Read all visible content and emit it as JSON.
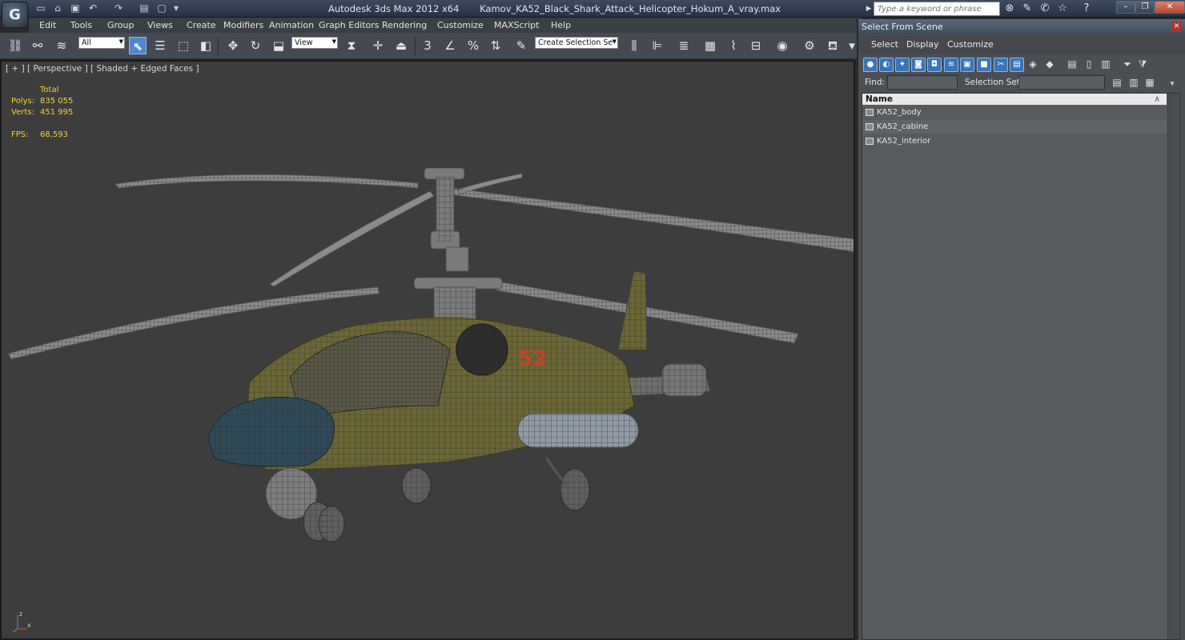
{
  "titlebar": {
    "app_name": "Autodesk 3ds Max  2012 x64",
    "file_name": "Kamov_KA52_Black_Shark_Attack_Helicopter_Hokum_A_vray.max",
    "search_placeholder": "Type a keyword or phrase",
    "logo_letter": "G"
  },
  "menu": [
    "Edit",
    "Tools",
    "Group",
    "Views",
    "Create",
    "Modifiers",
    "Animation",
    "Graph Editors",
    "Rendering",
    "Customize",
    "MAXScript",
    "Help"
  ],
  "toolbar": {
    "filter_select": "All",
    "reference_coord": "View",
    "selection_set": "Create Selection Se",
    "snap_label": "3",
    "percent_snap_label": "%"
  },
  "viewport": {
    "label": "[ + ] [ Perspective ] [ Shaded + Edged Faces ]",
    "stats": {
      "total_label": "Total",
      "polys_label": "Polys:",
      "polys_value": "835 055",
      "verts_label": "Verts:",
      "verts_value": "451 995",
      "fps_label": "FPS:",
      "fps_value": "68,593"
    },
    "axis": {
      "x": "x",
      "y": "y",
      "z": "z"
    },
    "helicopter_number": "52"
  },
  "panel": {
    "title": "Select From Scene",
    "menu": [
      "Select",
      "Display",
      "Customize"
    ],
    "find_label": "Find:",
    "find_value": "",
    "selection_set_label": "Selection Set:",
    "selection_set_value": "",
    "column_name": "Name",
    "sort_indicator": "∧",
    "objects": [
      "KA52_body",
      "KA52_cabine",
      "KA52_interior"
    ]
  },
  "colors": {
    "viewport_bg": "#3d3d3d",
    "stats_yellow": "#f2d13a",
    "wire_gray": "#8a8a8a",
    "hull_olive": "#6b6636",
    "canopy_blue": "#2f4a57"
  }
}
